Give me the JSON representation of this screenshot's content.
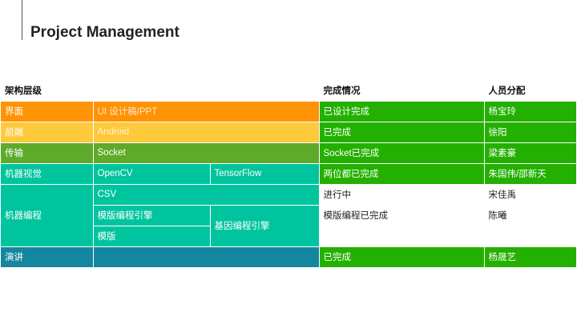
{
  "slide": {
    "title": "Project Management"
  },
  "table": {
    "headers": {
      "architecture": "架构层级",
      "status": "完成情况",
      "assignee": "人员分配"
    },
    "rows": {
      "ui": {
        "layer": "界面",
        "task": "UI 设计稿/PPT",
        "status": "已设计完成",
        "assignee": "杨宝玲"
      },
      "frontend": {
        "layer": "前端",
        "task": "Android",
        "status": "已完成",
        "assignee": "徐阳"
      },
      "transport": {
        "layer": "传输",
        "task": "Socket",
        "status": "Socket已完成",
        "assignee": "梁素豪"
      },
      "vision": {
        "layer": "机器视觉",
        "task1": "OpenCV",
        "task2": "TensorFlow",
        "status": "两位都已完成",
        "assignee": "朱国伟/邵新天"
      },
      "programming": {
        "layer": "机器编程",
        "csv": {
          "task": "CSV",
          "status": "进行中",
          "assignee": "宋佳禹"
        },
        "engine": {
          "task1": "模版编程引擎",
          "task2": "基因编程引擎",
          "status": "模版编程已完成",
          "assignee": "陈曦"
        },
        "template": {
          "task": "模版"
        }
      },
      "presentation": {
        "layer": "演讲",
        "status": "已完成",
        "assignee": "杨晟艺"
      }
    }
  },
  "colors": {
    "orange": "#ff9305",
    "yellow": "#ffc93c",
    "olive": "#5eaa2a",
    "teal": "#00c49e",
    "blue": "#15869f",
    "green": "#23b000"
  }
}
